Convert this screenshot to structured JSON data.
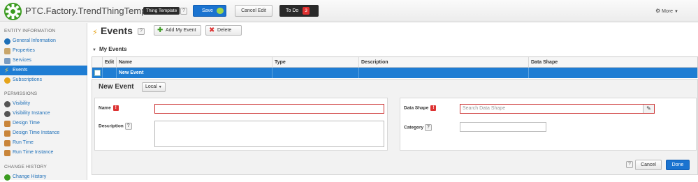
{
  "header": {
    "title": "PTC.Factory.TrendThingTemplate",
    "type_badge": "Thing Template",
    "help": "?",
    "save_label": "Save",
    "cancel_edit_label": "Cancel Edit",
    "todo_label": "To Do",
    "todo_count": "3",
    "more_label": "More"
  },
  "sidebar": {
    "sections": [
      {
        "label": "ENTITY INFORMATION"
      },
      {
        "label": "PERMISSIONS"
      },
      {
        "label": "CHANGE HISTORY"
      }
    ],
    "items": [
      {
        "label": "General Information",
        "icon": "info-icon"
      },
      {
        "label": "Properties",
        "icon": "properties-icon"
      },
      {
        "label": "Services",
        "icon": "services-icon"
      },
      {
        "label": "Events",
        "icon": "lightning-icon",
        "active": true
      },
      {
        "label": "Subscriptions",
        "icon": "subscriptions-icon"
      },
      {
        "label": "Visibility",
        "icon": "visibility-icon"
      },
      {
        "label": "Visibility Instance",
        "icon": "visibility-instance-icon"
      },
      {
        "label": "Design Time",
        "icon": "design-time-icon"
      },
      {
        "label": "Design Time Instance",
        "icon": "design-time-instance-icon"
      },
      {
        "label": "Run Time",
        "icon": "run-time-icon"
      },
      {
        "label": "Run Time Instance",
        "icon": "run-time-instance-icon"
      },
      {
        "label": "Change History",
        "icon": "change-history-icon"
      }
    ]
  },
  "main": {
    "title": "Events",
    "add_event_label": "Add My Event",
    "delete_label": "Delete",
    "section_title": "My Events",
    "grid": {
      "columns": [
        "Edit",
        "Name",
        "Type",
        "Description",
        "Data Shape"
      ],
      "rows": [
        {
          "name": "New Event",
          "type": "",
          "description": "",
          "data_shape": ""
        }
      ]
    },
    "editor": {
      "title": "New Event",
      "scope_label": "Local",
      "name_label": "Name",
      "description_label": "Description",
      "data_shape_label": "Data Shape",
      "data_shape_placeholder": "Search Data Shape",
      "category_label": "Category",
      "required_mark": "!",
      "cancel_label": "Cancel",
      "done_label": "Done"
    }
  },
  "colors": {
    "accent": "#1f7dd3",
    "required": "#dd3333",
    "todo_badge": "#e02f2f"
  }
}
